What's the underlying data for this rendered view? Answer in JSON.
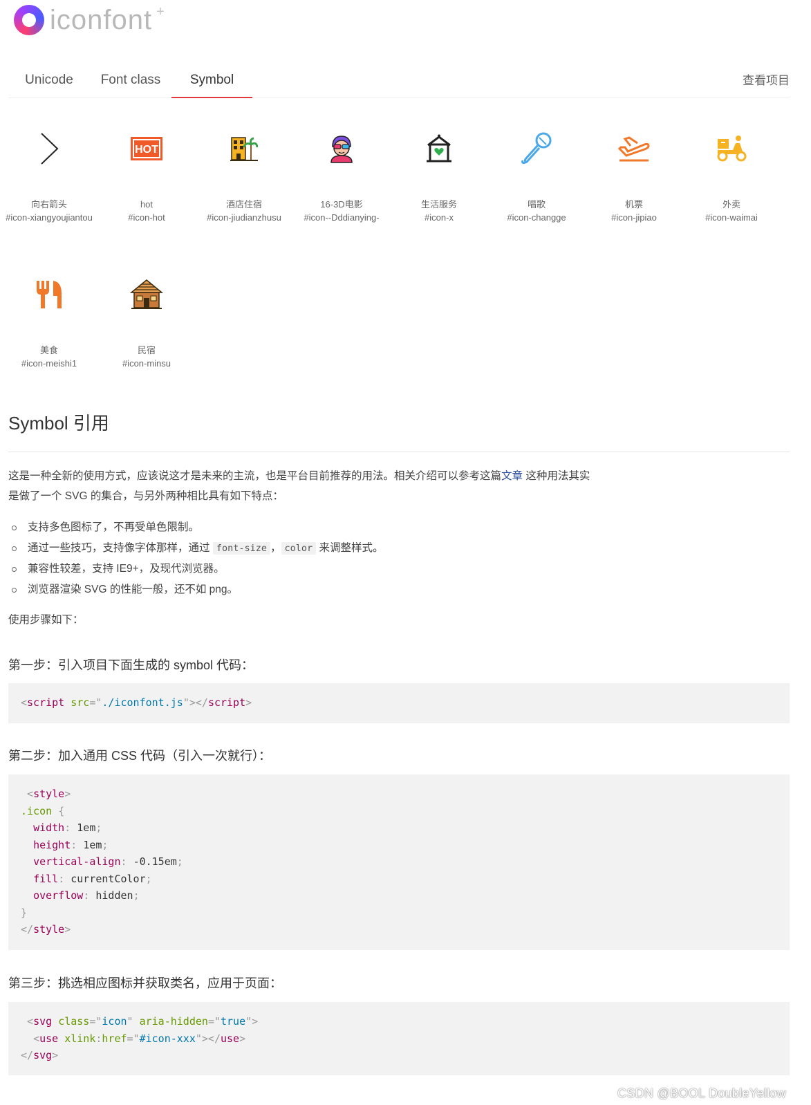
{
  "brand": {
    "name": "iconfont",
    "plus": "+"
  },
  "tabs": [
    {
      "label": "Unicode",
      "active": false
    },
    {
      "label": "Font class",
      "active": false
    },
    {
      "label": "Symbol",
      "active": true
    }
  ],
  "view_project": "查看项目",
  "icons": [
    {
      "name": "向右箭头",
      "code": "#icon-xiangyoujiantou",
      "icon": "chevron-right-icon"
    },
    {
      "name": "hot",
      "code": "#icon-hot",
      "icon": "hot-icon"
    },
    {
      "name": "酒店住宿",
      "code": "#icon-jiudianzhusu",
      "icon": "hotel-icon"
    },
    {
      "name": "16-3D电影",
      "code": "#icon--Dddianying-",
      "icon": "3d-movie-icon"
    },
    {
      "name": "生活服务",
      "code": "#icon-x",
      "icon": "life-service-icon"
    },
    {
      "name": "唱歌",
      "code": "#icon-changge",
      "icon": "microphone-icon"
    },
    {
      "name": "机票",
      "code": "#icon-jipiao",
      "icon": "airplane-icon"
    },
    {
      "name": "外卖",
      "code": "#icon-waimai",
      "icon": "delivery-scooter-icon"
    },
    {
      "name": "美食",
      "code": "#icon-meishi1",
      "icon": "food-icon"
    },
    {
      "name": "民宿",
      "code": "#icon-minsu",
      "icon": "homestay-icon"
    }
  ],
  "section": {
    "title": "Symbol 引用",
    "intro_1": "这是一种全新的使用方式，应该说这才是未来的主流，也是平台目前推荐的用法。相关介绍可以参考这篇",
    "intro_link": "文章",
    "intro_2": " 这种用法其实",
    "intro_3": "是做了一个 SVG 的集合，与另外两种相比具有如下特点：",
    "features": [
      "支持多色图标了，不再受单色限制。",
      "通过一些技巧，支持像字体那样，通过",
      "兼容性较差，支持 IE9+，及现代浏览器。",
      "浏览器渲染 SVG 的性能一般，还不如 png。"
    ],
    "feature2_code1": "font-size",
    "feature2_sep": "，",
    "feature2_code2": "color",
    "feature2_tail": " 来调整样式。",
    "steps_intro": "使用步骤如下：",
    "step1": "第一步：引入项目下面生成的 symbol 代码：",
    "step2": "第二步：加入通用 CSS 代码（引入一次就行）：",
    "step3": "第三步：挑选相应图标并获取类名，应用于页面："
  },
  "code1": {
    "tag": "script",
    "attr": "src",
    "value": "./iconfont.js"
  },
  "code2": {
    "tag": "style",
    "selector": ".icon",
    "rules": [
      {
        "prop": "width",
        "val": "1em"
      },
      {
        "prop": "height",
        "val": "1em"
      },
      {
        "prop": "vertical-align",
        "val": "-0.15em"
      },
      {
        "prop": "fill",
        "val": "currentColor"
      },
      {
        "prop": "overflow",
        "val": "hidden"
      }
    ]
  },
  "code3": {
    "svg_tag": "svg",
    "class_attr": "class",
    "class_val": "icon",
    "aria_attr": "aria-hidden",
    "aria_val": "true",
    "use_tag": "use",
    "href_ns": "xlink",
    "href_attr": "href",
    "href_val": "#icon-xxx"
  },
  "watermark": "CSDN @BOOL DoubleYellow",
  "colors": {
    "accent": "#e4393c",
    "code_bg": "#f2f2f2"
  }
}
